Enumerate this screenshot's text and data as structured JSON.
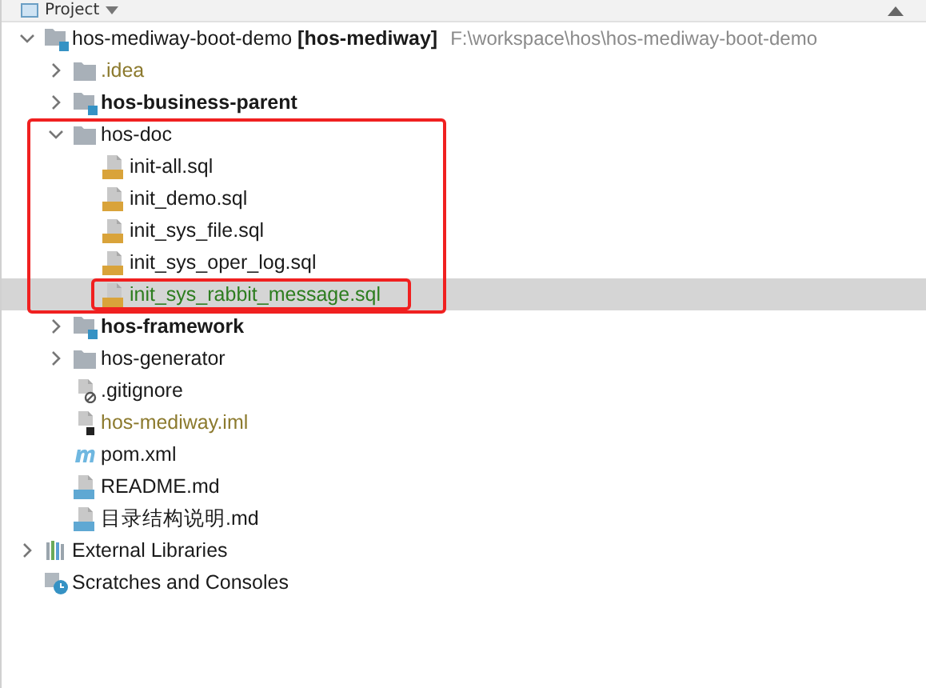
{
  "header": {
    "title": "Project"
  },
  "tree": [
    {
      "name": "hos-mediway-boot-demo **[hos-mediway]**",
      "path": "F:\\workspace\\hos\\hos-mediway-boot-demo",
      "kind": "module",
      "bold": false,
      "ignored": false,
      "added": false,
      "expanded": true,
      "selected": false,
      "annotated": false,
      "children": [
        {
          "name": ".idea",
          "kind": "folder",
          "bold": false,
          "ignored": true,
          "added": false,
          "expanded": false,
          "selected": false,
          "annotated": false
        },
        {
          "name": "hos-business-parent",
          "kind": "module",
          "bold": true,
          "ignored": false,
          "added": false,
          "expanded": false,
          "selected": false,
          "annotated": false
        },
        {
          "name": "hos-doc",
          "kind": "folder",
          "bold": false,
          "ignored": false,
          "added": false,
          "expanded": true,
          "selected": false,
          "annotated": true,
          "children": [
            {
              "name": "init-all.sql",
              "kind": "sql",
              "bold": false,
              "ignored": false,
              "added": false,
              "selected": false,
              "annotated": false
            },
            {
              "name": "init_demo.sql",
              "kind": "sql",
              "bold": false,
              "ignored": false,
              "added": false,
              "selected": false,
              "annotated": false
            },
            {
              "name": "init_sys_file.sql",
              "kind": "sql",
              "bold": false,
              "ignored": false,
              "added": false,
              "selected": false,
              "annotated": false
            },
            {
              "name": "init_sys_oper_log.sql",
              "kind": "sql",
              "bold": false,
              "ignored": false,
              "added": false,
              "selected": false,
              "annotated": false
            },
            {
              "name": "init_sys_rabbit_message.sql",
              "kind": "sql",
              "bold": false,
              "ignored": false,
              "added": true,
              "selected": true,
              "annotated": true
            }
          ]
        },
        {
          "name": "hos-framework",
          "kind": "module",
          "bold": true,
          "ignored": false,
          "added": false,
          "expanded": false,
          "selected": false,
          "annotated": false
        },
        {
          "name": "hos-generator",
          "kind": "folder",
          "bold": false,
          "ignored": false,
          "added": false,
          "expanded": false,
          "selected": false,
          "annotated": false
        },
        {
          "name": ".gitignore",
          "kind": "gitignore",
          "bold": false,
          "ignored": false,
          "added": false,
          "selected": false,
          "annotated": false
        },
        {
          "name": "hos-mediway.iml",
          "kind": "iml",
          "bold": false,
          "ignored": true,
          "added": false,
          "selected": false,
          "annotated": false
        },
        {
          "name": "pom.xml",
          "kind": "maven",
          "bold": false,
          "ignored": false,
          "added": false,
          "selected": false,
          "annotated": false
        },
        {
          "name": "README.md",
          "kind": "md",
          "bold": false,
          "ignored": false,
          "added": false,
          "selected": false,
          "annotated": false
        },
        {
          "name": "目录结构说明.md",
          "kind": "md",
          "bold": false,
          "ignored": false,
          "added": false,
          "selected": false,
          "annotated": false
        }
      ]
    },
    {
      "name": "External Libraries",
      "kind": "libraries",
      "bold": false,
      "ignored": false,
      "added": false,
      "expanded": false,
      "selected": false,
      "annotated": false
    },
    {
      "name": "Scratches and Consoles",
      "kind": "scratches",
      "bold": false,
      "ignored": false,
      "added": false,
      "selected": false,
      "annotated": false
    }
  ]
}
